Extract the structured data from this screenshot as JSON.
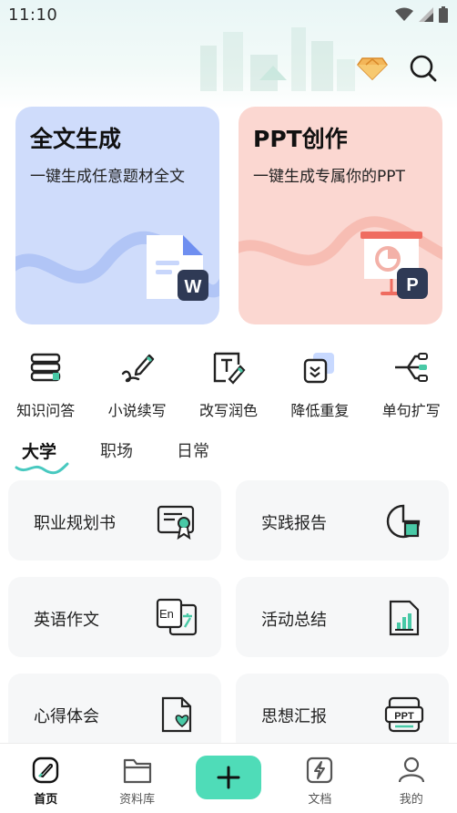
{
  "status_bar": {
    "time": "11:10"
  },
  "header": {
    "premium_icon": "diamond-icon",
    "search_icon": "search-icon"
  },
  "hero_cards": [
    {
      "title": "全文生成",
      "subtitle": "一键生成任意题材全文",
      "badge": "W"
    },
    {
      "title": "PPT创作",
      "subtitle": "一键生成专属你的PPT",
      "badge": "P"
    }
  ],
  "tools": [
    {
      "label": "知识问答",
      "icon": "books-icon"
    },
    {
      "label": "小说续写",
      "icon": "pen-icon"
    },
    {
      "label": "改写润色",
      "icon": "text-edit-icon"
    },
    {
      "label": "降低重复",
      "icon": "reduce-duplicate-icon"
    },
    {
      "label": "单句扩写",
      "icon": "expand-icon"
    }
  ],
  "tabs": [
    "大学",
    "职场",
    "日常"
  ],
  "active_tab": "大学",
  "cards": [
    {
      "label": "职业规划书",
      "icon": "certificate-icon"
    },
    {
      "label": "实践报告",
      "icon": "pie-chart-icon"
    },
    {
      "label": "英语作文",
      "icon": "translate-icon"
    },
    {
      "label": "活动总结",
      "icon": "bar-chart-doc-icon"
    },
    {
      "label": "心得体会",
      "icon": "heart-doc-icon"
    },
    {
      "label": "思想汇报",
      "icon": "ppt-icon"
    }
  ],
  "bottom_nav": [
    {
      "label": "首页",
      "icon": "home-pen-icon"
    },
    {
      "label": "资料库",
      "icon": "folder-icon"
    },
    {
      "label": "",
      "icon": "plus-icon"
    },
    {
      "label": "文档",
      "icon": "document-bolt-icon"
    },
    {
      "label": "我的",
      "icon": "user-icon"
    }
  ],
  "colors": {
    "accent": "#4fdcb8",
    "hero_left_bg": "#cfdcfb",
    "hero_right_bg": "#fbd7d1",
    "card_bg": "#f6f7f8"
  }
}
